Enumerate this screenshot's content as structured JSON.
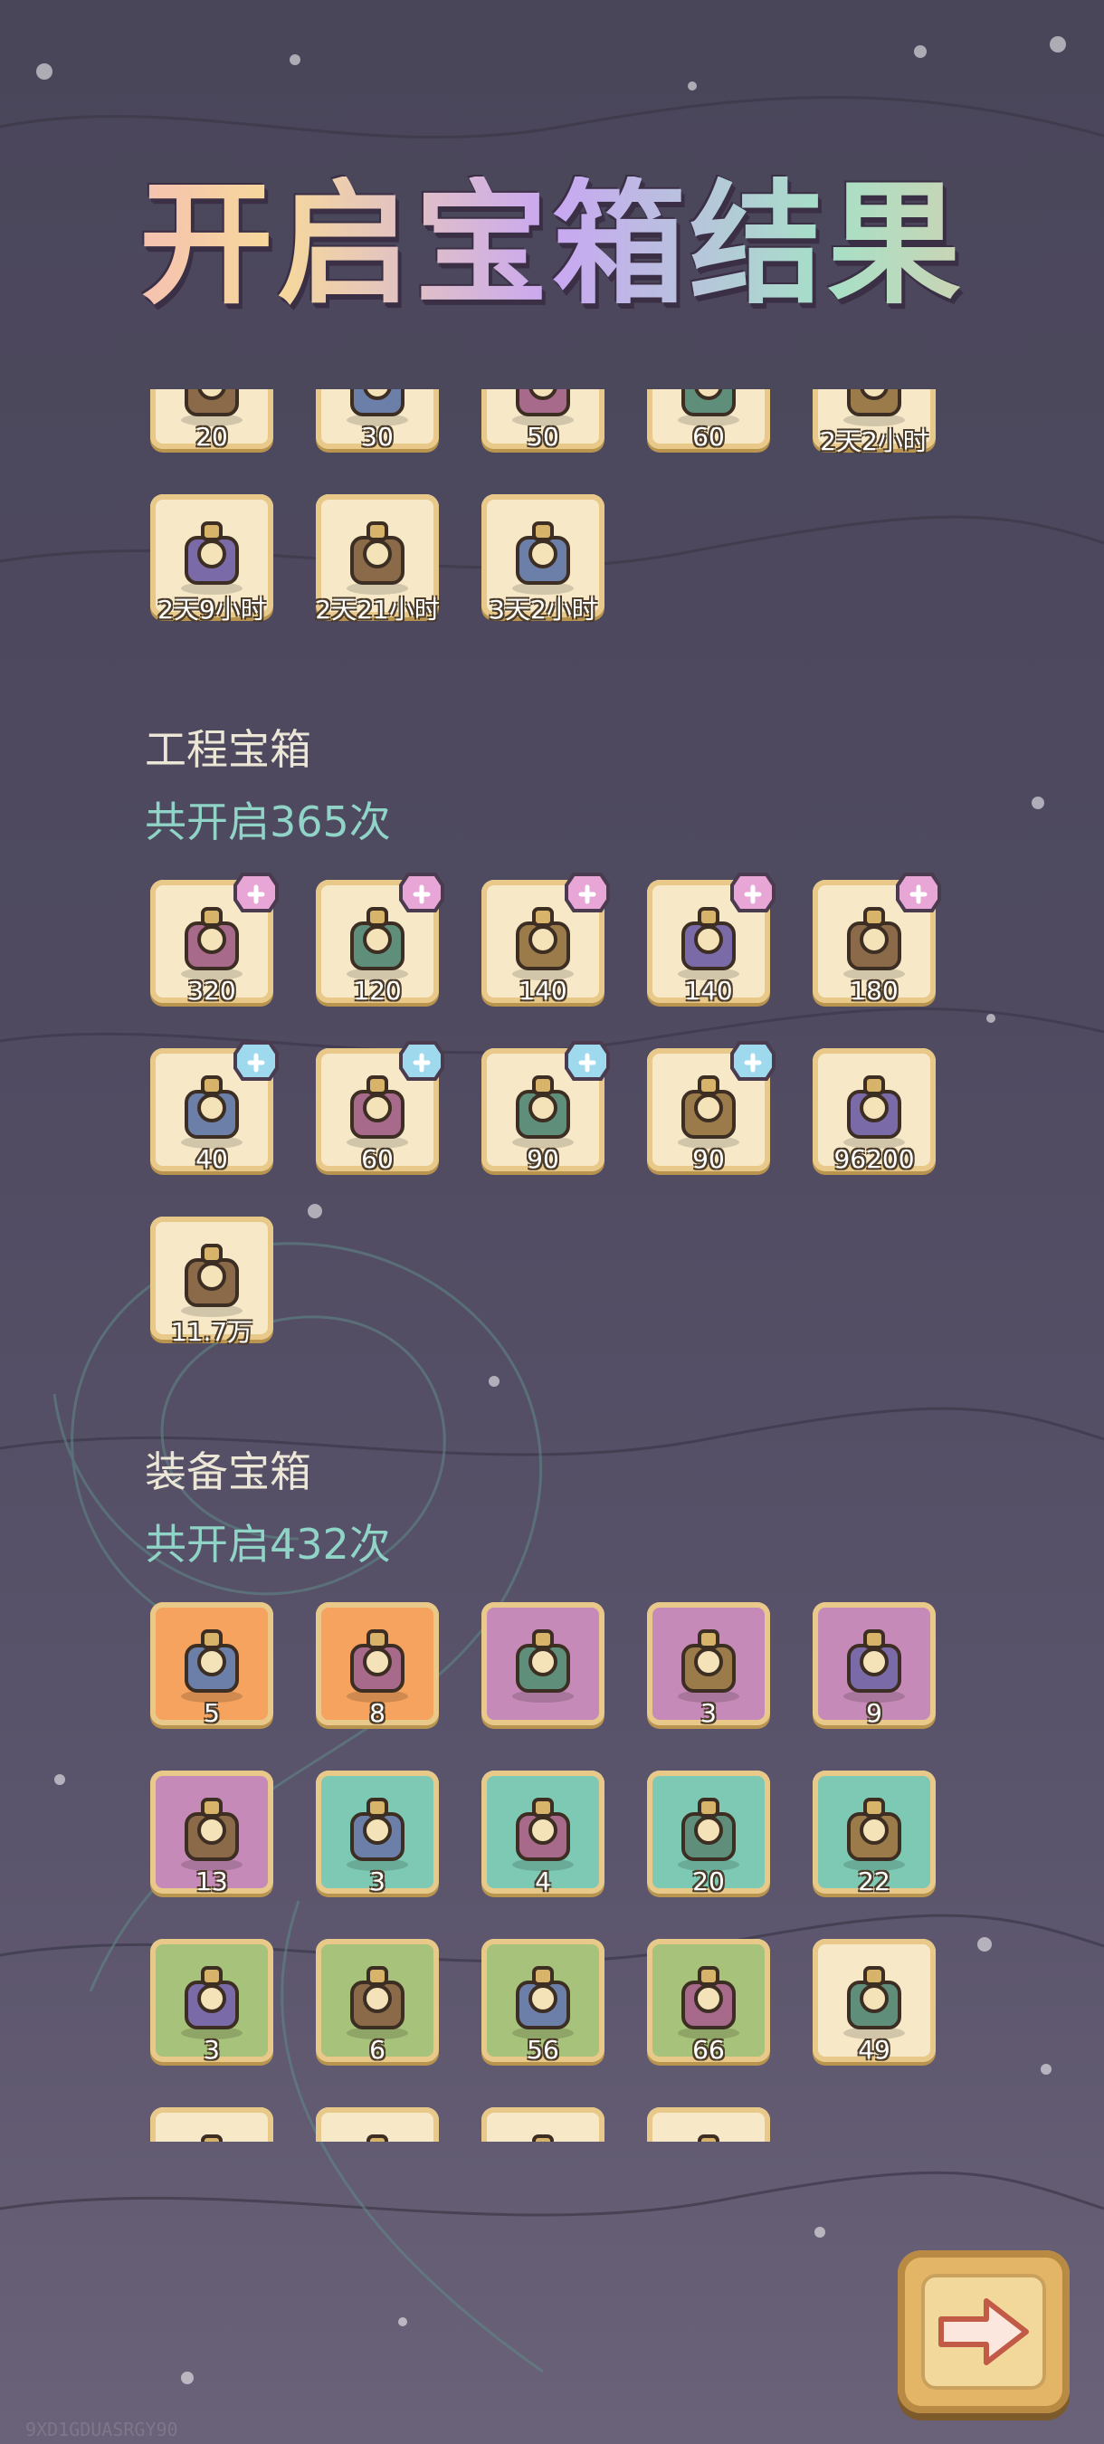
{
  "title": "开启宝箱结果",
  "sections": [
    {
      "rows": [
        [
          {
            "label": "20",
            "color": "cream",
            "icon": "clock-tower-icon"
          },
          {
            "label": "30",
            "color": "cream",
            "icon": "machine-icon"
          },
          {
            "label": "50",
            "color": "cream",
            "icon": "cart-icon"
          },
          {
            "label": "60",
            "color": "cream",
            "icon": "shield-icon"
          },
          {
            "label": "2天2小时",
            "color": "cream",
            "icon": "dress-icon"
          }
        ],
        [
          {
            "label": "2天9小时",
            "color": "cream",
            "icon": "molecule-icon"
          },
          {
            "label": "2天21小时",
            "color": "cream",
            "icon": "hourglass-icon"
          },
          {
            "label": "3天2小时",
            "color": "cream",
            "icon": "snail-flask-icon"
          }
        ]
      ]
    },
    {
      "name": "工程宝箱",
      "count_text": "共开启365次",
      "rows": [
        [
          {
            "label": "320",
            "color": "cream",
            "icon": "telescope-machine-icon",
            "badge": "pink"
          },
          {
            "label": "120",
            "color": "cream",
            "icon": "monitor-icon",
            "badge": "pink"
          },
          {
            "label": "140",
            "color": "cream",
            "icon": "loom-icon",
            "badge": "pink"
          },
          {
            "label": "140",
            "color": "cream",
            "icon": "airship-icon",
            "badge": "pink"
          },
          {
            "label": "180",
            "color": "cream",
            "icon": "lamp-device-icon",
            "badge": "pink"
          }
        ],
        [
          {
            "label": "40",
            "color": "cream",
            "icon": "sextant-icon",
            "badge": "blue"
          },
          {
            "label": "60",
            "color": "cream",
            "icon": "grinder-icon",
            "badge": "blue"
          },
          {
            "label": "90",
            "color": "cream",
            "icon": "workbench-icon",
            "badge": "blue"
          },
          {
            "label": "90",
            "color": "cream",
            "icon": "engine-icon",
            "badge": "blue"
          },
          {
            "label": "96200",
            "color": "cream",
            "icon": "stone-icon"
          }
        ],
        [
          {
            "label": "11.7万",
            "color": "cream",
            "icon": "wood-logs-icon"
          }
        ]
      ]
    },
    {
      "name": "装备宝箱",
      "count_text": "共开启432次",
      "rows": [
        [
          {
            "label": "5",
            "color": "orange",
            "icon": "feather-brooch-icon"
          },
          {
            "label": "8",
            "color": "orange",
            "icon": "ring-icon"
          },
          {
            "label": "",
            "color": "purple",
            "icon": "dragon-ring-icon"
          },
          {
            "label": "3",
            "color": "purple",
            "icon": "crystal-claw-icon"
          },
          {
            "label": "9",
            "color": "purple",
            "icon": "tag-amulet-icon"
          }
        ],
        [
          {
            "label": "13",
            "color": "purple",
            "icon": "red-amulet-icon"
          },
          {
            "label": "3",
            "color": "teal",
            "icon": "green-gem-ring-icon"
          },
          {
            "label": "4",
            "color": "teal",
            "icon": "clover-ring-icon"
          },
          {
            "label": "20",
            "color": "teal",
            "icon": "ruby-pendant-icon"
          },
          {
            "label": "22",
            "color": "teal",
            "icon": "sapphire-pendant-icon"
          }
        ],
        [
          {
            "label": "3",
            "color": "green",
            "icon": "flower-ring-icon"
          },
          {
            "label": "6",
            "color": "green",
            "icon": "claw-ring-icon"
          },
          {
            "label": "56",
            "color": "green",
            "icon": "black-pearl-icon"
          },
          {
            "label": "66",
            "color": "green",
            "icon": "white-pearl-icon"
          },
          {
            "label": "49",
            "color": "cream",
            "icon": "flower-crown-icon"
          }
        ],
        [
          {
            "label": "",
            "color": "cream",
            "icon": "item-icon"
          },
          {
            "label": "",
            "color": "cream",
            "icon": "item-icon"
          },
          {
            "label": "",
            "color": "cream",
            "icon": "item-icon"
          },
          {
            "label": "",
            "color": "cream",
            "icon": "item-icon"
          }
        ]
      ]
    }
  ],
  "next_button_icon": "right-arrow-icon",
  "watermark": "9XD1GDUASRGY90"
}
